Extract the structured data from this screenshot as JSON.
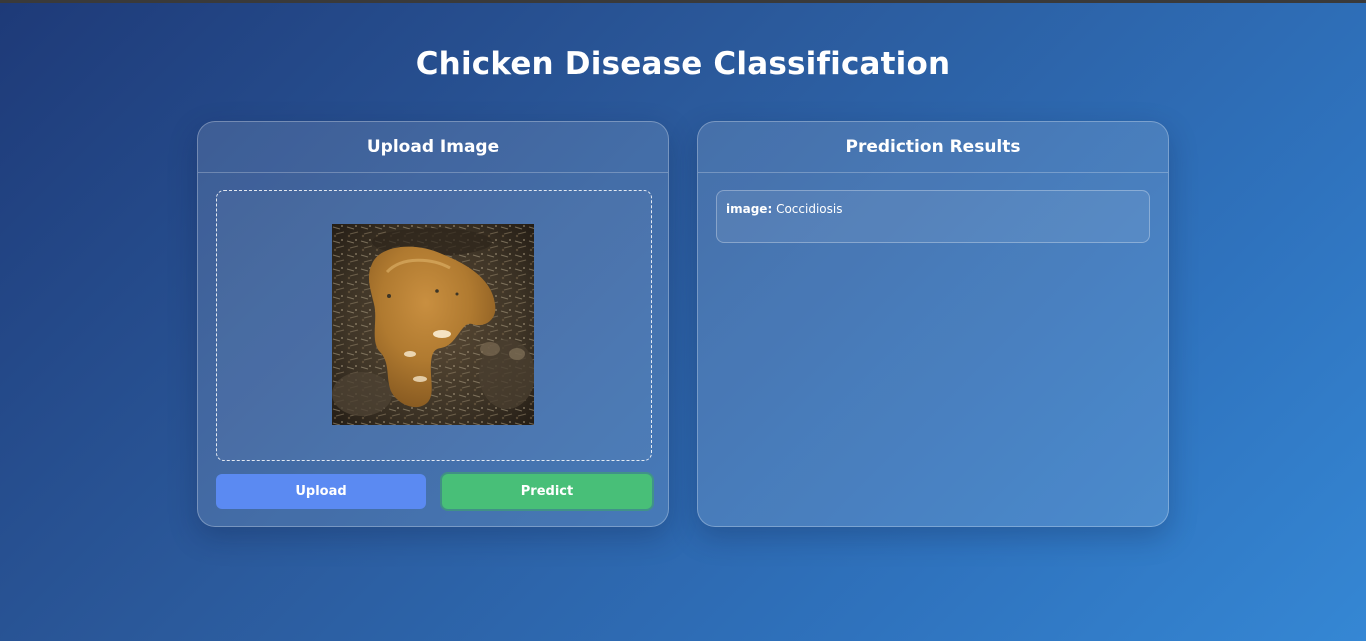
{
  "page": {
    "title": "Chicken Disease Classification"
  },
  "upload_panel": {
    "header": "Upload Image",
    "preview_icon": "chicken-dropping-photo",
    "upload_label": "Upload",
    "predict_label": "Predict"
  },
  "results_panel": {
    "header": "Prediction Results",
    "result_key": "image:",
    "result_value": "Coccidiosis"
  },
  "colors": {
    "upload_button": "#5b8af2",
    "predict_button": "#48bf78",
    "background_start": "#1e3a78",
    "background_end": "#3587d4"
  }
}
